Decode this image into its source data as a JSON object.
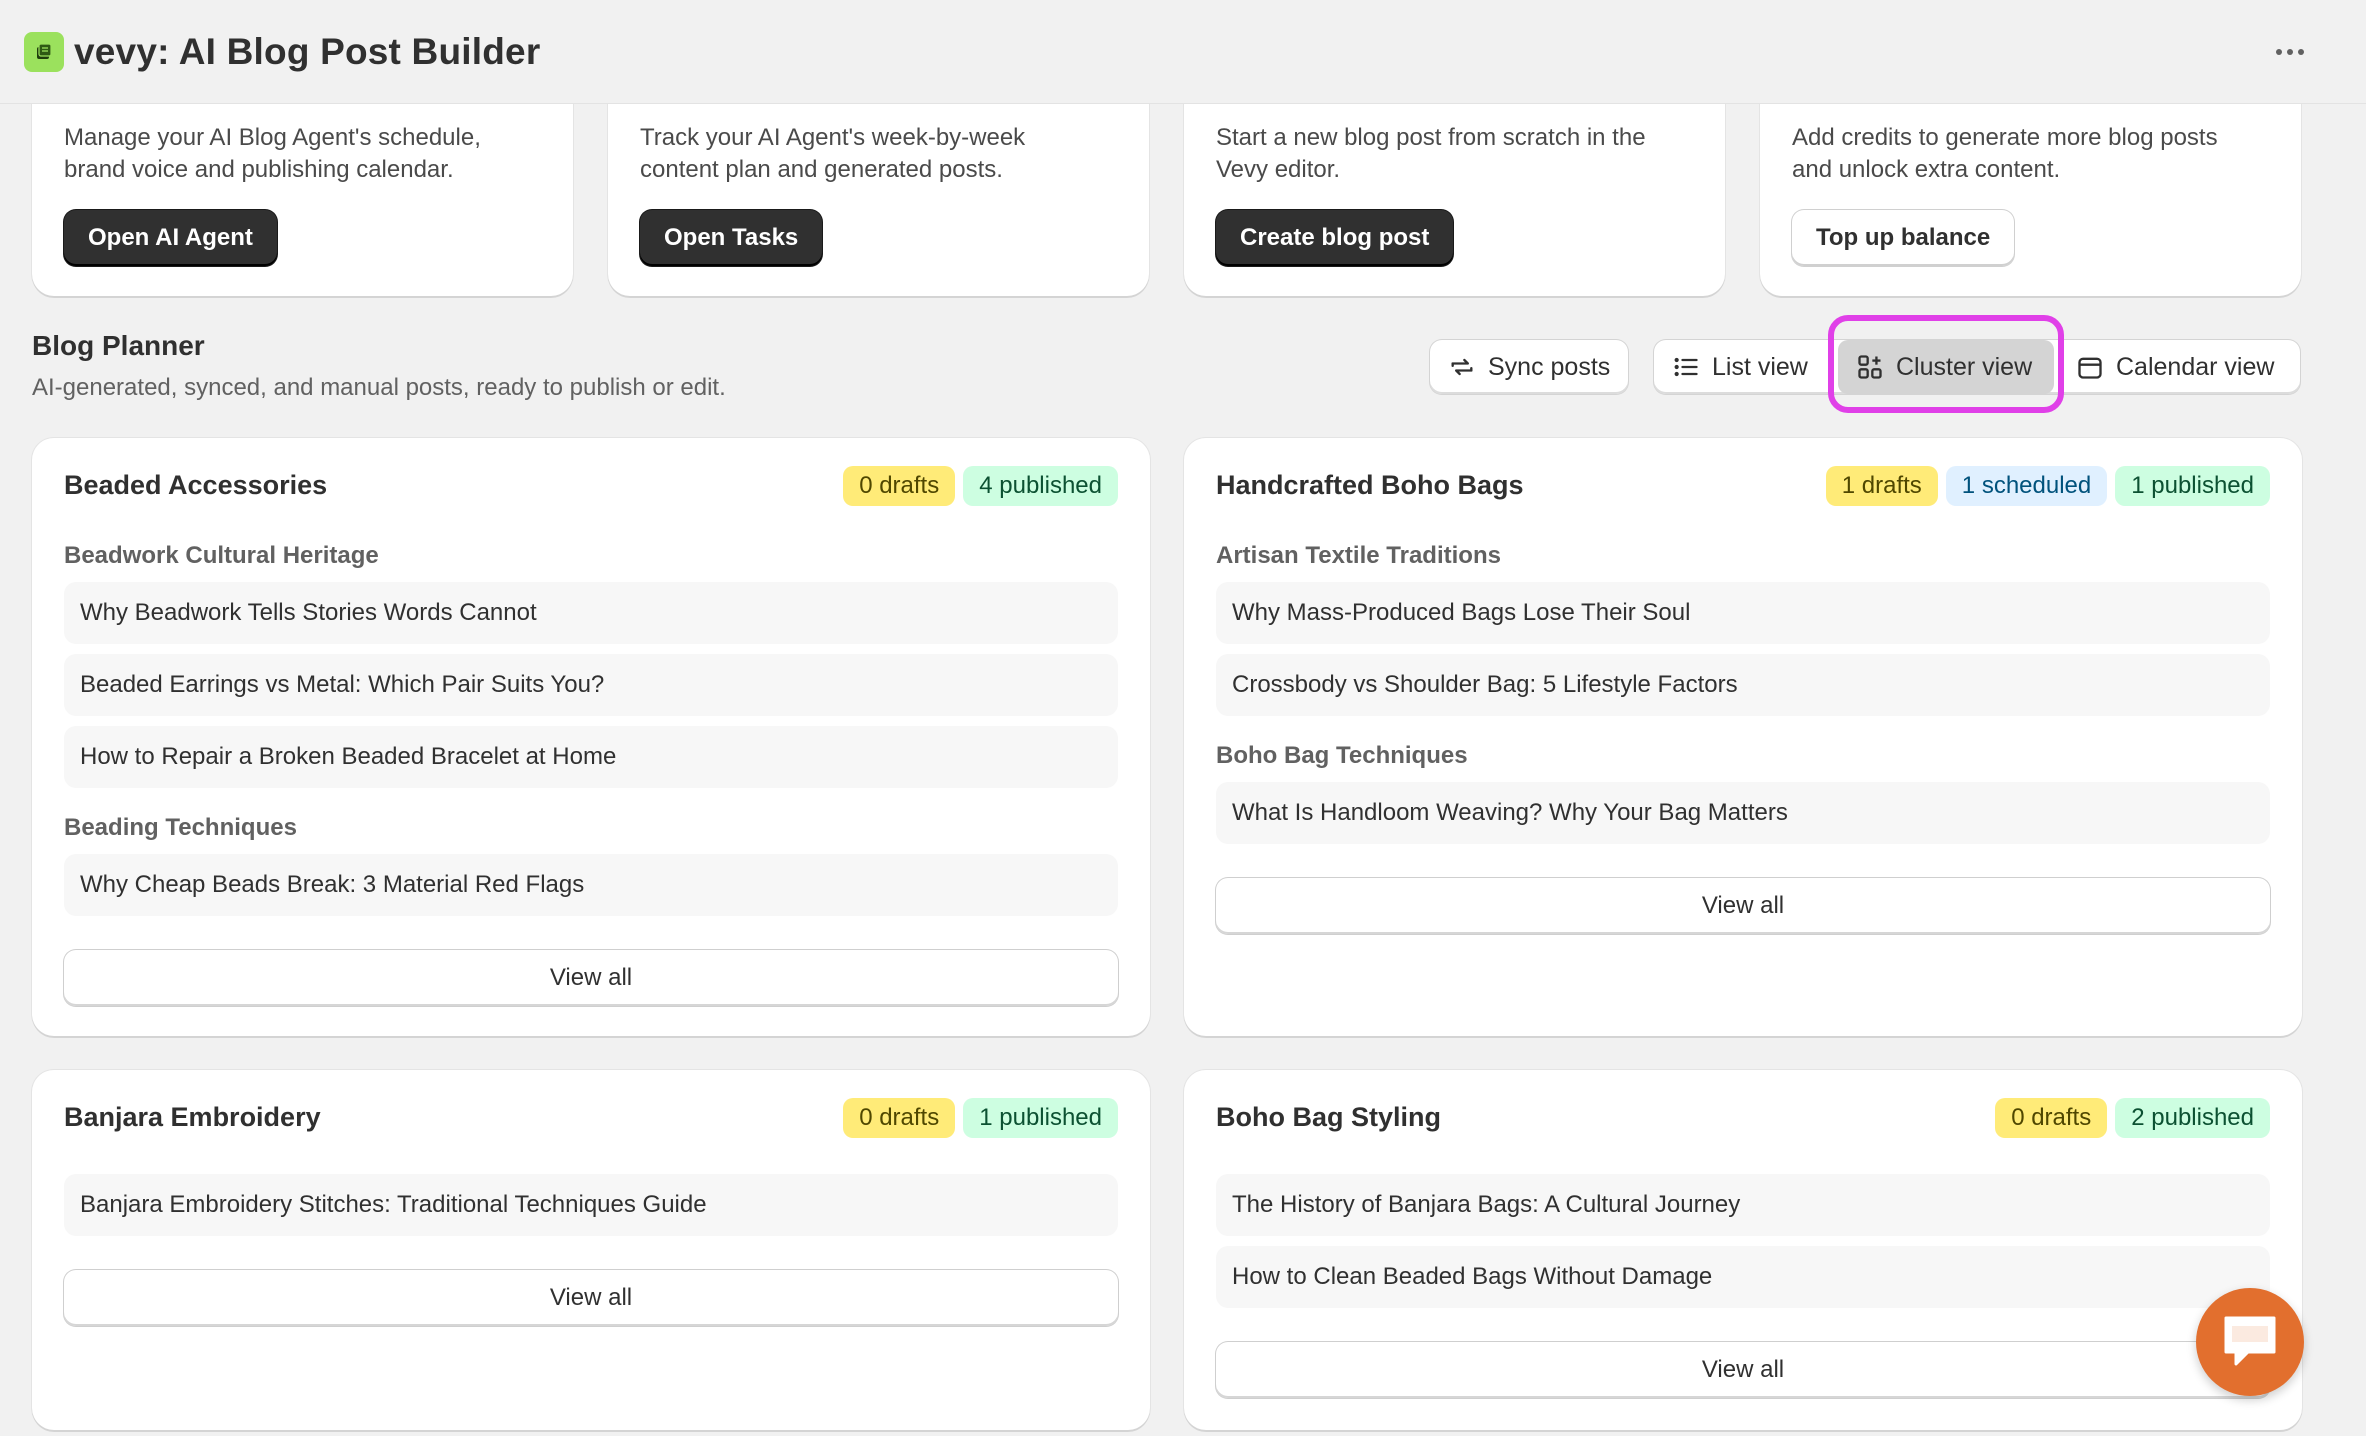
{
  "app": {
    "title": "vevy: AI Blog Post Builder"
  },
  "top_cards": [
    {
      "desc_line1": "Manage your AI Blog Agent's schedule,",
      "desc_line2": "brand voice and publishing calendar.",
      "button": "Open AI Agent"
    },
    {
      "desc_line1": "Track your AI Agent's week-by-week",
      "desc_line2": "content plan and generated posts.",
      "button": "Open Tasks"
    },
    {
      "desc_line1": "Start a new blog post from scratch in the",
      "desc_line2": "Vevy editor.",
      "button": "Create blog post"
    },
    {
      "desc_line1": "Add credits to generate more blog posts",
      "desc_line2": "and unlock extra content.",
      "button": "Top up balance"
    }
  ],
  "planner": {
    "title": "Blog Planner",
    "subtitle": "AI-generated, synced, and manual posts, ready to publish or edit.",
    "sync": "Sync posts",
    "list_view": "List view",
    "cluster_view": "Cluster view",
    "calendar_view": "Calendar view"
  },
  "clusters": [
    {
      "title": "Beaded Accessories",
      "badges": [
        "0 drafts",
        "4 published"
      ],
      "sections": [
        {
          "label": "Beadwork Cultural Heritage",
          "posts": [
            "Why Beadwork Tells Stories Words Cannot",
            "Beaded Earrings vs Metal: Which Pair Suits You?",
            "How to Repair a Broken Beaded Bracelet at Home"
          ]
        },
        {
          "label": "Beading Techniques",
          "posts": [
            "Why Cheap Beads Break: 3 Material Red Flags"
          ]
        }
      ],
      "view_all": "View all"
    },
    {
      "title": "Handcrafted Boho Bags",
      "badges": [
        "1 drafts",
        "1 scheduled",
        "1 published"
      ],
      "sections": [
        {
          "label": "Artisan Textile Traditions",
          "posts": [
            "Why Mass-Produced Bags Lose Their Soul",
            "Crossbody vs Shoulder Bag: 5 Lifestyle Factors"
          ]
        },
        {
          "label": "Boho Bag Techniques",
          "posts": [
            "What Is Handloom Weaving? Why Your Bag Matters"
          ]
        }
      ],
      "view_all": "View all"
    },
    {
      "title": "Banjara Embroidery",
      "badges": [
        "0 drafts",
        "1 published"
      ],
      "sections": [
        {
          "label": "",
          "posts": [
            "Banjara Embroidery Stitches: Traditional Techniques Guide"
          ]
        }
      ],
      "view_all": "View all"
    },
    {
      "title": "Boho Bag Styling",
      "badges": [
        "0 drafts",
        "2 published"
      ],
      "sections": [
        {
          "label": "",
          "posts": [
            "The History of Banjara Bags: A Cultural Journey",
            "How to Clean Beaded Bags Without Damage"
          ]
        }
      ],
      "view_all": "View all"
    }
  ],
  "colors": {
    "highlight": "#e040e8",
    "chat_fab": "#e26f2e",
    "logo": "#9be15d"
  }
}
